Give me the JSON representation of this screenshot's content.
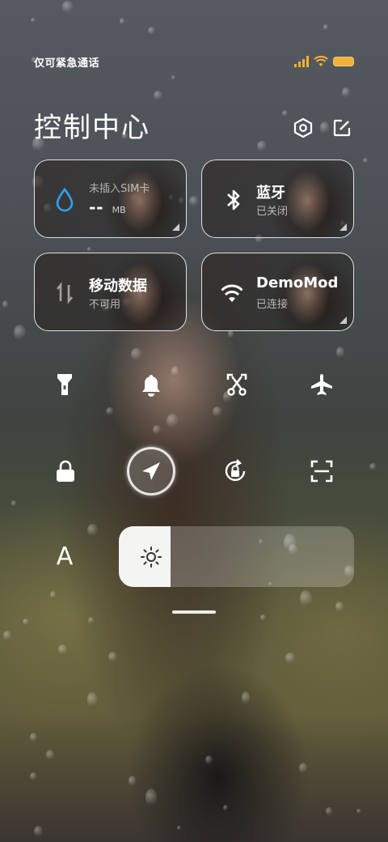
{
  "status_bar": {
    "carrier_text": "仅可紧急通话",
    "signal_icon": "signal-bars-icon",
    "wifi_icon": "wifi-icon",
    "battery_icon": "battery-icon",
    "battery_color": "#f1b23a"
  },
  "header": {
    "title": "控制中心",
    "settings_icon": "settings-hexagon-icon",
    "edit_icon": "edit-icon"
  },
  "tiles": [
    {
      "id": "sim",
      "label": "未插入SIM卡",
      "value": "--",
      "unit": "MB",
      "icon": "water-drop-icon",
      "icon_color": "#2aa3f5"
    },
    {
      "id": "bluetooth",
      "title": "蓝牙",
      "subtitle": "已关闭",
      "icon": "bluetooth-icon"
    },
    {
      "id": "mobile-data",
      "title": "移动数据",
      "subtitle": "不可用",
      "icon": "data-arrows-icon"
    },
    {
      "id": "wifi",
      "title": "DemoMod",
      "subtitle": "已连接",
      "icon": "wifi-icon"
    }
  ],
  "toggles": [
    {
      "name": "flashlight-toggle",
      "icon": "flashlight-icon",
      "active": false
    },
    {
      "name": "bell-toggle",
      "icon": "bell-icon",
      "active": false
    },
    {
      "name": "screenshot-toggle",
      "icon": "scissors-screenshot-icon",
      "active": false
    },
    {
      "name": "airplane-toggle",
      "icon": "airplane-icon",
      "active": false
    },
    {
      "name": "lock-screen-toggle",
      "icon": "lock-icon",
      "active": false
    },
    {
      "name": "location-toggle",
      "icon": "location-arrow-icon",
      "active": true
    },
    {
      "name": "rotation-lock-toggle",
      "icon": "rotation-lock-icon",
      "active": false
    },
    {
      "name": "scan-toggle",
      "icon": "scan-icon",
      "active": false
    }
  ],
  "brightness": {
    "font_size_label": "A",
    "level_fraction": 0.22,
    "icon": "sun-icon"
  }
}
